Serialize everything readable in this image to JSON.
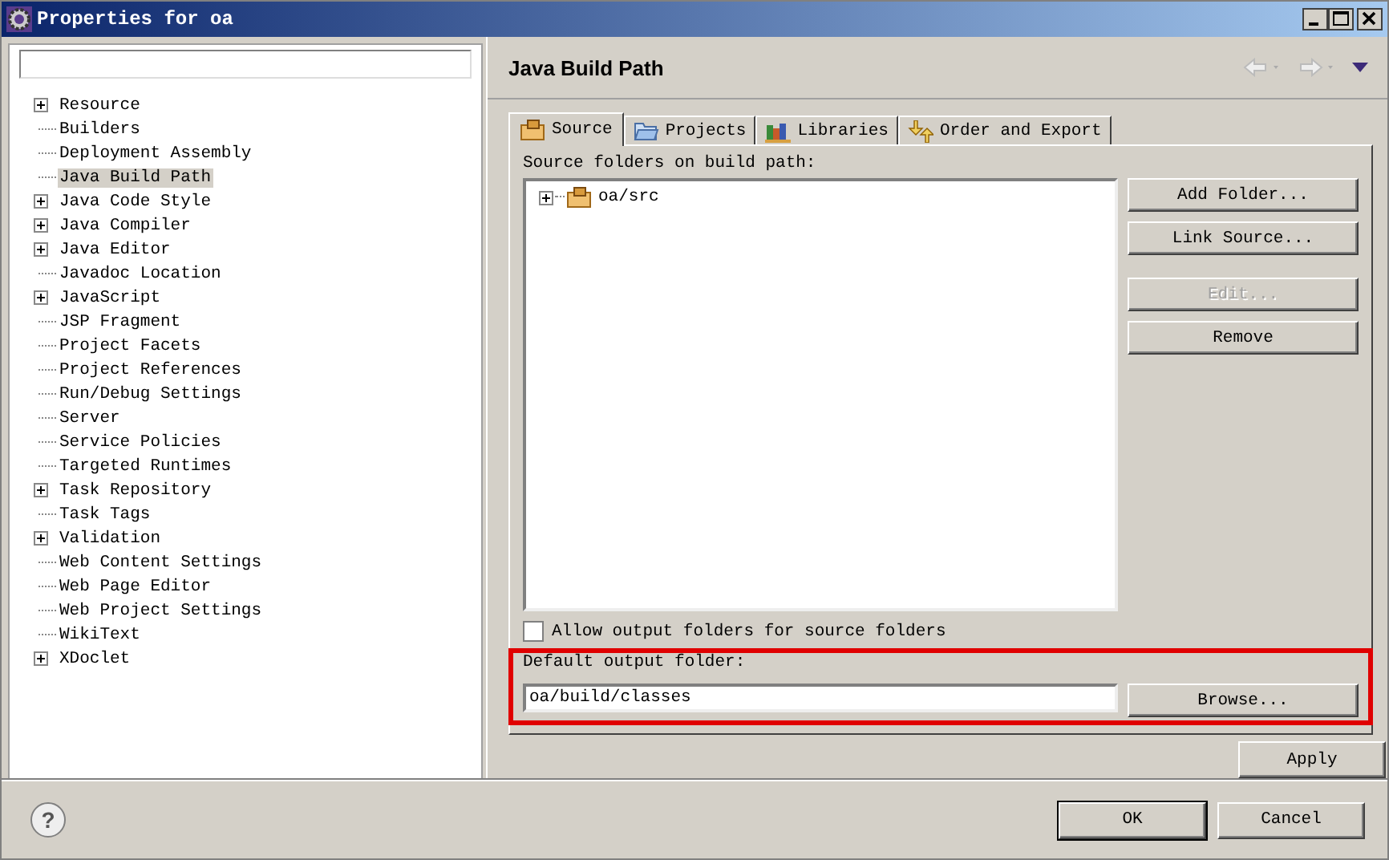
{
  "window": {
    "title": "Properties for oa"
  },
  "tree": [
    {
      "label": "Resource",
      "kind": "group",
      "selected": false
    },
    {
      "label": "Builders",
      "kind": "page",
      "selected": false
    },
    {
      "label": "Deployment Assembly",
      "kind": "page",
      "selected": false
    },
    {
      "label": "Java Build Path",
      "kind": "page",
      "selected": true
    },
    {
      "label": "Java Code Style",
      "kind": "group",
      "selected": false
    },
    {
      "label": "Java Compiler",
      "kind": "group",
      "selected": false
    },
    {
      "label": "Java Editor",
      "kind": "group",
      "selected": false
    },
    {
      "label": "Javadoc Location",
      "kind": "page",
      "selected": false
    },
    {
      "label": "JavaScript",
      "kind": "group",
      "selected": false
    },
    {
      "label": "JSP Fragment",
      "kind": "page",
      "selected": false
    },
    {
      "label": "Project Facets",
      "kind": "page",
      "selected": false
    },
    {
      "label": "Project References",
      "kind": "page",
      "selected": false
    },
    {
      "label": "Run/Debug Settings",
      "kind": "page",
      "selected": false
    },
    {
      "label": "Server",
      "kind": "page",
      "selected": false
    },
    {
      "label": "Service Policies",
      "kind": "page",
      "selected": false
    },
    {
      "label": "Targeted Runtimes",
      "kind": "page",
      "selected": false
    },
    {
      "label": "Task Repository",
      "kind": "group",
      "selected": false
    },
    {
      "label": "Task Tags",
      "kind": "page",
      "selected": false
    },
    {
      "label": "Validation",
      "kind": "group",
      "selected": false
    },
    {
      "label": "Web Content Settings",
      "kind": "page",
      "selected": false
    },
    {
      "label": "Web Page Editor",
      "kind": "page",
      "selected": false
    },
    {
      "label": "Web Project Settings",
      "kind": "page",
      "selected": false
    },
    {
      "label": "WikiText",
      "kind": "page",
      "selected": false
    },
    {
      "label": "XDoclet",
      "kind": "group",
      "selected": false
    }
  ],
  "page_title": "Java Build Path",
  "tabs": [
    {
      "label": "Source",
      "kind": "source",
      "selected": true
    },
    {
      "label": "Projects",
      "kind": "projects",
      "selected": false
    },
    {
      "label": "Libraries",
      "kind": "libraries",
      "selected": false
    },
    {
      "label": "Order and Export",
      "kind": "order",
      "selected": false
    }
  ],
  "source_label": "Source folders on build path:",
  "source_folders": [
    {
      "label": "oa/src",
      "expanded": false
    }
  ],
  "side_buttons": [
    {
      "label": "Add Folder...",
      "disabled": false
    },
    {
      "label": "Link Source...",
      "disabled": false
    },
    {
      "label": "Edit...",
      "disabled": true
    },
    {
      "label": "Remove",
      "disabled": false
    }
  ],
  "allow_output": {
    "label": "Allow output folders for source folders",
    "checked": false
  },
  "output": {
    "label": "Default output folder:",
    "value": "oa/build/classes",
    "button": "Browse..."
  },
  "apply": "Apply",
  "help": "?",
  "buttons": [
    "OK",
    "Cancel"
  ]
}
